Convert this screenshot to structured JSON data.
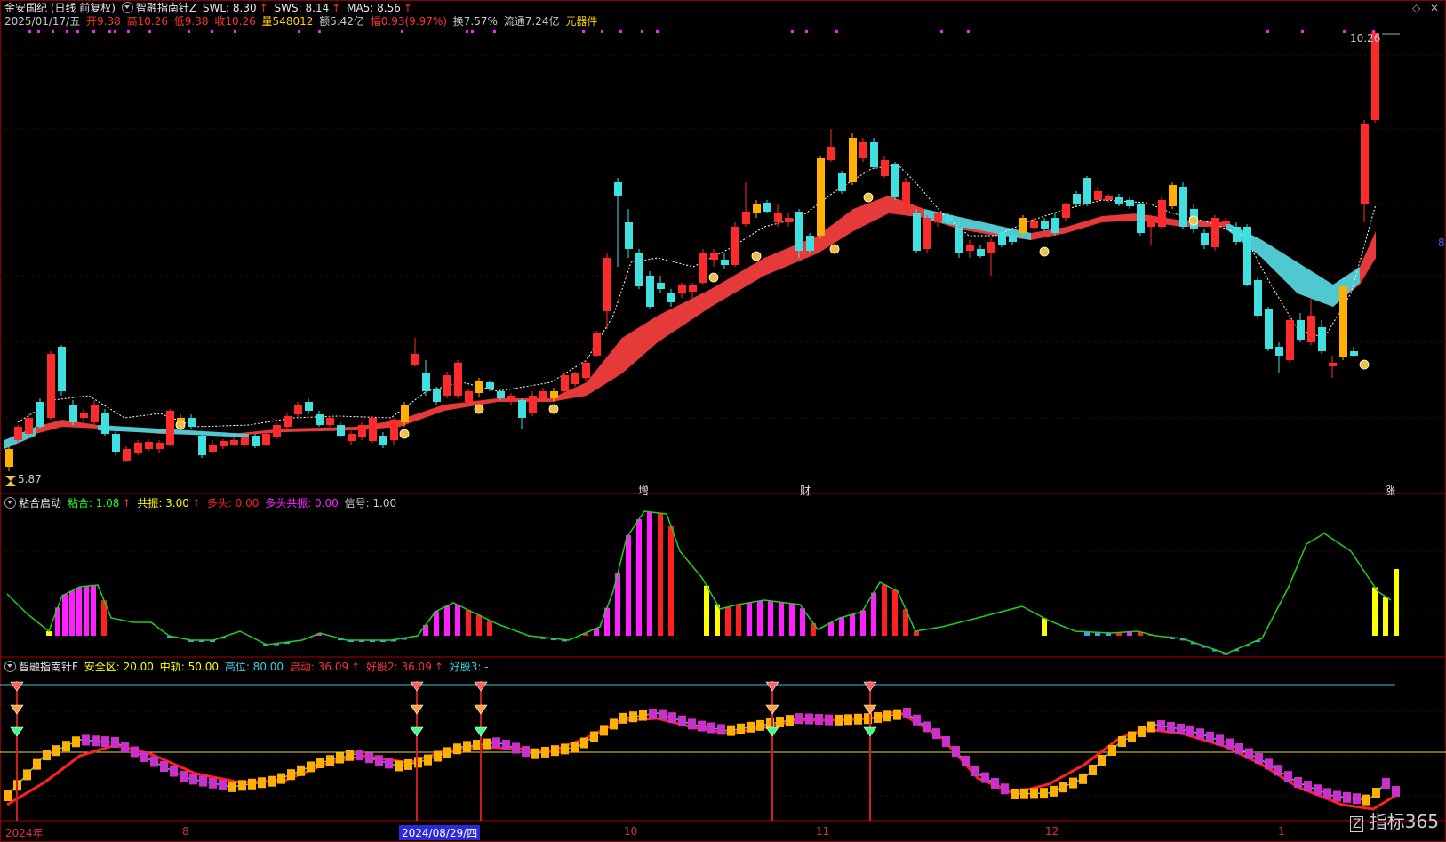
{
  "header": {
    "stock": "金安国纪 (日线 前复权)",
    "indicator_name": "智融指南针Z",
    "swl_label": "SWL: 8.30",
    "sws_label": "SWS: 8.14",
    "ma5_label": "MA5: 8.56",
    "date": "2025/01/17/五",
    "open": "开9.38",
    "high": "高10.26",
    "low": "低9.38",
    "close": "收10.26",
    "volume": "量548012",
    "amount": "额5.42亿",
    "change": "幅0.93(9.97%)",
    "turnover": "换7.57%",
    "float": "流通7.24亿",
    "component": "元器件"
  },
  "main_panel": {
    "high_price_label": "10.26",
    "low_price_label": "5.87",
    "marks": [
      "增",
      "财",
      "涨"
    ],
    "side_label": "8"
  },
  "panel2": {
    "title": "粘合启动",
    "nianhe": "粘合: 1.08",
    "gongzhen": "共振: 3.00",
    "duotou": "多头: 0.00",
    "duotou_gongzhen": "多头共振: 0.00",
    "xinhao": "信号: 1.00"
  },
  "panel3": {
    "title": "智融指南针F",
    "safe": "安全区: 20.00",
    "mid": "中轨: 50.00",
    "high": "高位: 80.00",
    "start": "启动: 36.09",
    "good1": "好股2: 36.09",
    "good2": "好股3: -"
  },
  "xaxis": [
    "2024年",
    "8",
    "2024/08/29/四",
    "10",
    "11",
    "12",
    "1"
  ],
  "logo": "指标365",
  "colors": {
    "up": "#ff2b2b",
    "down": "#40e0e0",
    "gold": "#ffb000",
    "magenta": "#ff20ff",
    "band": "#ff4040",
    "teal": "#4fc8d0"
  }
}
